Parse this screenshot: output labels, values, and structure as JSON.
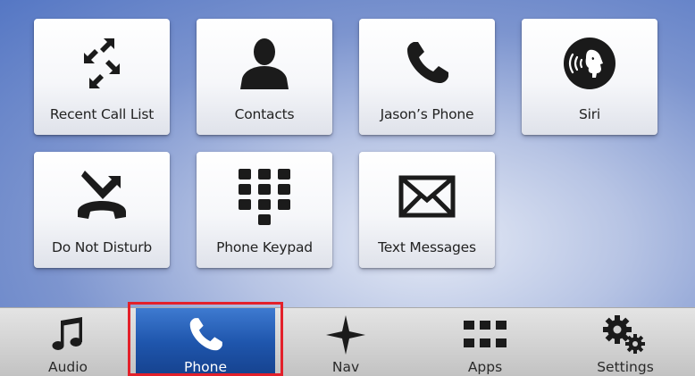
{
  "tiles": [
    {
      "label": "Recent Call List",
      "icon": "recent-calls-arrows-icon"
    },
    {
      "label": "Contacts",
      "icon": "person-silhouette-icon"
    },
    {
      "label": "Jason’s Phone",
      "icon": "phone-handset-icon"
    },
    {
      "label": "Siri",
      "icon": "siri-voice-icon"
    },
    {
      "label": "Do Not Disturb",
      "icon": "do-not-disturb-icon"
    },
    {
      "label": "Phone Keypad",
      "icon": "keypad-grid-icon"
    },
    {
      "label": "Text Messages",
      "icon": "envelope-icon"
    }
  ],
  "navbar": {
    "items": [
      {
        "label": "Audio",
        "icon": "music-note-icon",
        "active": false
      },
      {
        "label": "Phone",
        "icon": "phone-handset-icon",
        "active": true
      },
      {
        "label": "Nav",
        "icon": "compass-star-icon",
        "active": false
      },
      {
        "label": "Apps",
        "icon": "apps-grid-icon",
        "active": false
      },
      {
        "label": "Settings",
        "icon": "gears-icon",
        "active": false
      }
    ]
  },
  "colors": {
    "background_blue": "#5577c4",
    "active_tab_blue": "#1f56ad",
    "highlight_red": "#e3202a",
    "navbar_gray": "#d0d0d0"
  }
}
